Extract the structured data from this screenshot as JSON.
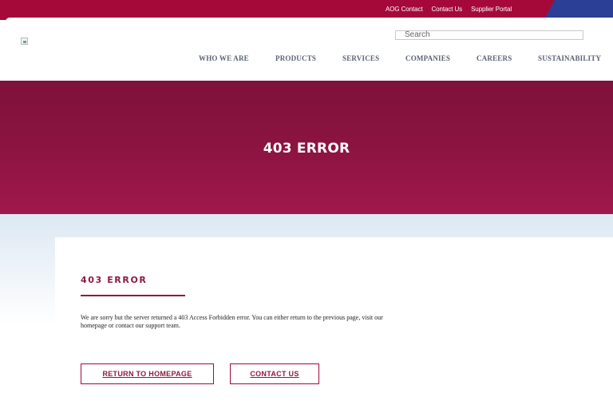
{
  "top_links": [
    "AOG Contact",
    "Contact Us",
    "Supplier Portal"
  ],
  "search": {
    "placeholder": "Search"
  },
  "nav": [
    "WHO WE ARE",
    "PRODUCTS",
    "SERVICES",
    "COMPANIES",
    "CAREERS",
    "SUSTAINABILITY"
  ],
  "hero": {
    "title": "403 ERROR"
  },
  "content": {
    "heading": "403 ERROR",
    "message": "We are sorry but the server returned a 403 Access Forbidden error. You can either return to the previous page, visit our homepage or contact our support team.",
    "return_button": "RETURN TO HOMEPAGE",
    "contact_button": "CONTACT US"
  },
  "colors": {
    "brand_red": "#a4093a",
    "brand_blue": "#2c3f96",
    "hero_dark": "#7e1239",
    "hero_light": "#a0184c"
  }
}
